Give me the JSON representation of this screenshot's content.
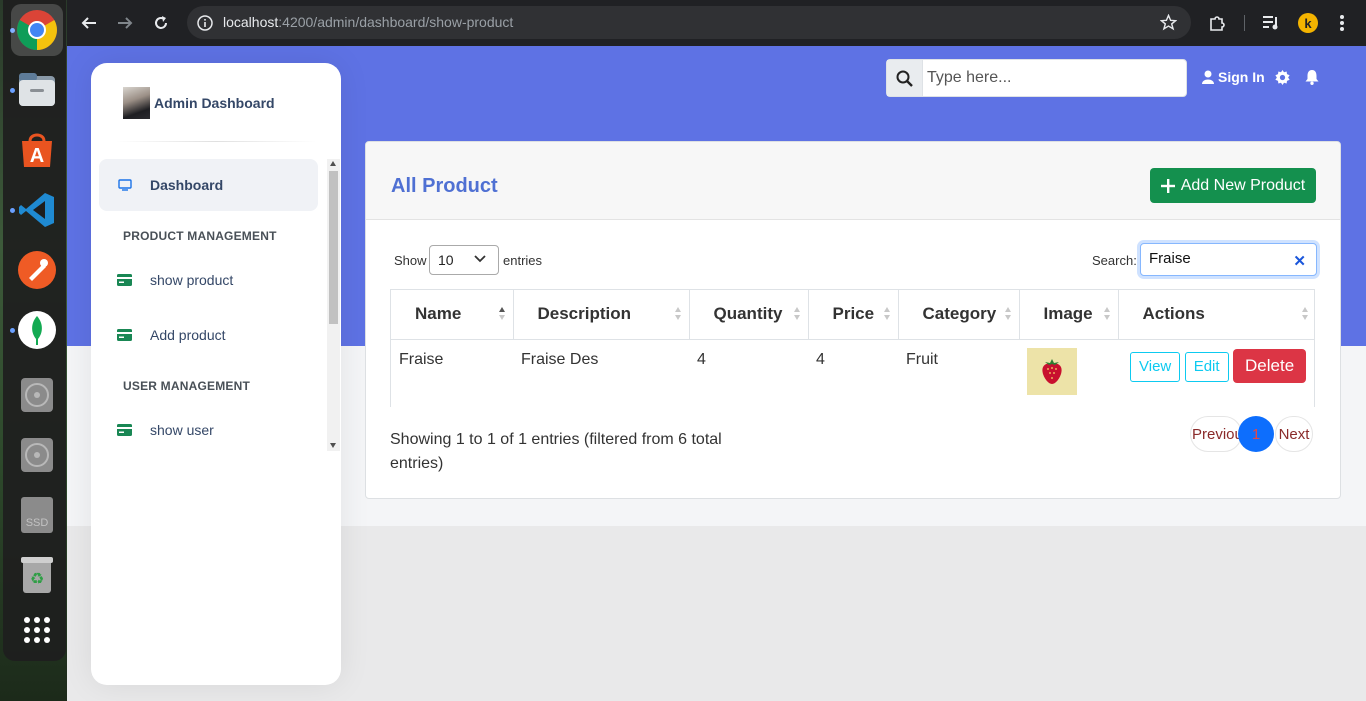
{
  "browser": {
    "url_host": "localhost",
    "url_path": ":4200/admin/dashboard/show-product"
  },
  "topnav": {
    "search_placeholder": "Type here...",
    "signin_label": "Sign In"
  },
  "sidebar": {
    "brand": "Admin Dashboard",
    "items": [
      {
        "label": "Dashboard",
        "icon": "monitor-icon",
        "active": true
      },
      {
        "label": "show product",
        "icon": "card-icon"
      },
      {
        "label": "Add product",
        "icon": "card-icon"
      },
      {
        "label": "show user",
        "icon": "card-icon"
      }
    ],
    "headings": [
      "PRODUCT MANAGEMENT",
      "USER MANAGEMENT"
    ]
  },
  "card": {
    "title": "All Product",
    "add_button": "Add New Product"
  },
  "datatable": {
    "length_prefix": "Show",
    "length_value": "10",
    "length_suffix": "entries",
    "search_label": "Search:",
    "search_value": "Fraise",
    "columns": [
      "Name",
      "Description",
      "Quantity",
      "Price",
      "Category",
      "Image",
      "Actions"
    ],
    "rows": [
      {
        "name": "Fraise",
        "description": "Fraise Des",
        "quantity": "4",
        "price": "4",
        "category": "Fruit",
        "actions": {
          "view": "View",
          "edit": "Edit",
          "delete": "Delete"
        }
      }
    ],
    "info": "Showing 1 to 1 of 1 entries (filtered from 6 total entries)",
    "pager": {
      "prev": "Previous",
      "current": "1",
      "next": "Next"
    }
  },
  "colors": {
    "hero": "#5e72e4",
    "title": "#4f70d3",
    "add_button": "#14904e",
    "delete_button": "#dc3545",
    "outline_info": "#0dcaf0",
    "page_active": "#0d6efd"
  }
}
